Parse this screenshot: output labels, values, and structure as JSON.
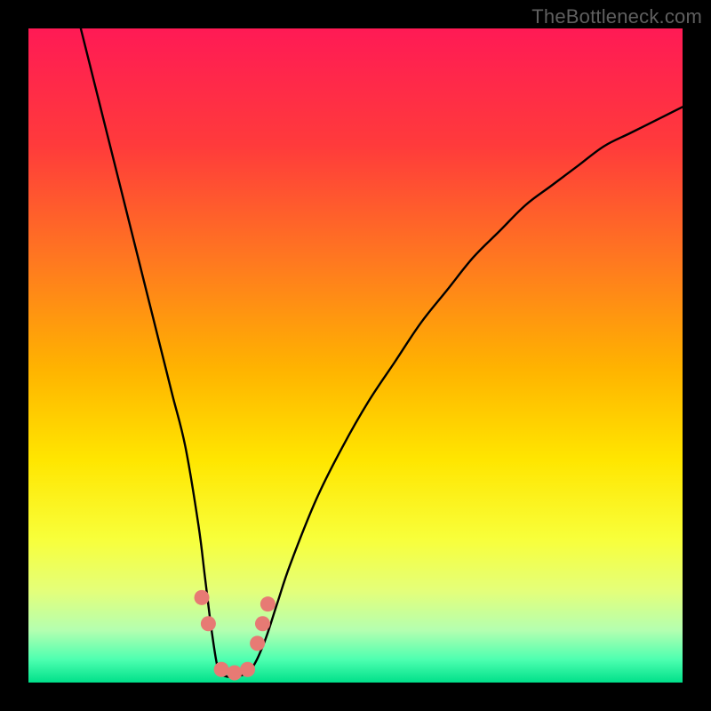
{
  "watermark": "TheBottleneck.com",
  "chart_data": {
    "type": "line",
    "title": "",
    "xlabel": "",
    "ylabel": "",
    "xlim": [
      0,
      100
    ],
    "ylim": [
      0,
      100
    ],
    "series": [
      {
        "name": "curve",
        "x": [
          8,
          10,
          12,
          14,
          16,
          18,
          20,
          22,
          24,
          26,
          27,
          28,
          29,
          30,
          32,
          34,
          36,
          38,
          40,
          44,
          48,
          52,
          56,
          60,
          64,
          68,
          72,
          76,
          80,
          84,
          88,
          92,
          96,
          100
        ],
        "y": [
          100,
          92,
          84,
          76,
          68,
          60,
          52,
          44,
          36,
          24,
          16,
          8,
          2,
          1,
          1,
          2,
          6,
          12,
          18,
          28,
          36,
          43,
          49,
          55,
          60,
          65,
          69,
          73,
          76,
          79,
          82,
          84,
          86,
          88
        ]
      },
      {
        "name": "markers",
        "x": [
          26.5,
          27.5,
          29.5,
          31.5,
          33.5,
          35.0,
          35.8,
          36.6
        ],
        "y": [
          13,
          9,
          2,
          1.5,
          2,
          6,
          9,
          12
        ]
      }
    ],
    "gradient_stops": [
      {
        "offset": 0.0,
        "color": "#ff1a55"
      },
      {
        "offset": 0.18,
        "color": "#ff3b3b"
      },
      {
        "offset": 0.36,
        "color": "#ff7a1f"
      },
      {
        "offset": 0.52,
        "color": "#ffb300"
      },
      {
        "offset": 0.66,
        "color": "#ffe600"
      },
      {
        "offset": 0.78,
        "color": "#f8ff3a"
      },
      {
        "offset": 0.86,
        "color": "#e4ff7a"
      },
      {
        "offset": 0.92,
        "color": "#b4ffb0"
      },
      {
        "offset": 0.965,
        "color": "#4dffb0"
      },
      {
        "offset": 1.0,
        "color": "#00e08a"
      }
    ],
    "marker_color": "#e77a74",
    "curve_color": "#000000"
  }
}
